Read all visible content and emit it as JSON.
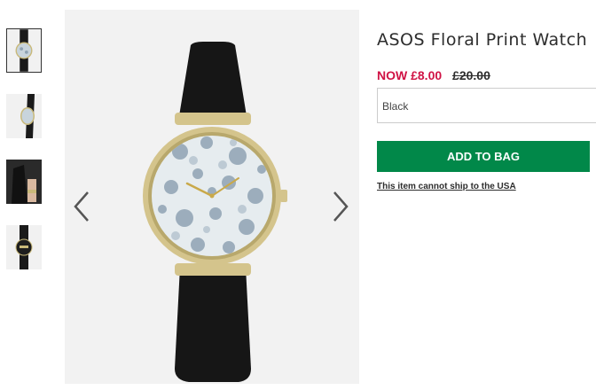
{
  "product": {
    "title": "ASOS Floral Print Watch",
    "price_now": "NOW £8.00",
    "price_was": "£20.00",
    "colour": "Black",
    "add_to_bag": "ADD TO BAG",
    "shipping_notice": "This item cannot ship to the USA"
  },
  "gallery": {
    "thumbnail_count": 4,
    "selected_index": 0,
    "prev_icon": "chevron-left-icon",
    "next_icon": "chevron-right-icon"
  },
  "colors": {
    "price_now": "#d01345",
    "button": "#018849",
    "strap": "#161616",
    "case": "#d4c48c"
  }
}
